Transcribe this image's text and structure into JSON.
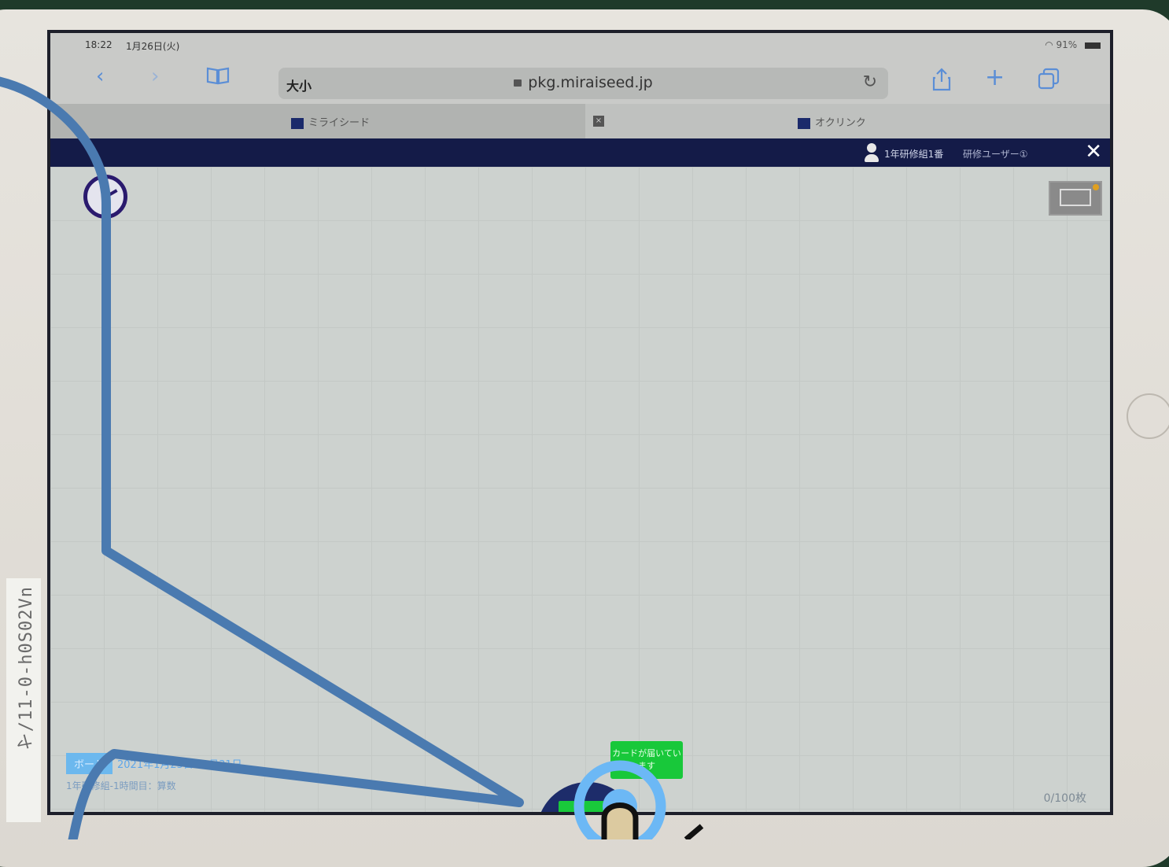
{
  "status_bar": {
    "time": "18:22",
    "date": "1月26日(火)",
    "battery": "91%"
  },
  "browser": {
    "text_size_button": "大小",
    "url": "pkg.miraiseed.jp",
    "tabs": [
      {
        "label": "ミライシード",
        "active": true
      },
      {
        "label": "",
        "active": false
      },
      {
        "label": "オクリンク",
        "active": false
      }
    ]
  },
  "app_header": {
    "class_name": "1年研修組1番",
    "user_name": "研修ユーザー①"
  },
  "canvas": {
    "card_notice": "カードが届いています",
    "card_count": "0/100枚",
    "date_label": "ボード",
    "date_range": "2021年1月25日~1月31日",
    "class_info": "1年研修組-1時間目：算数"
  },
  "sticker": {
    "text": "ヤ/11-0-h0S02Vn"
  },
  "colors": {
    "app_header_bg": "#141b48",
    "accent_green": "#19c93b",
    "annotation_blue": "#4a7ab0",
    "tap_ring": "#6cb8f5"
  }
}
